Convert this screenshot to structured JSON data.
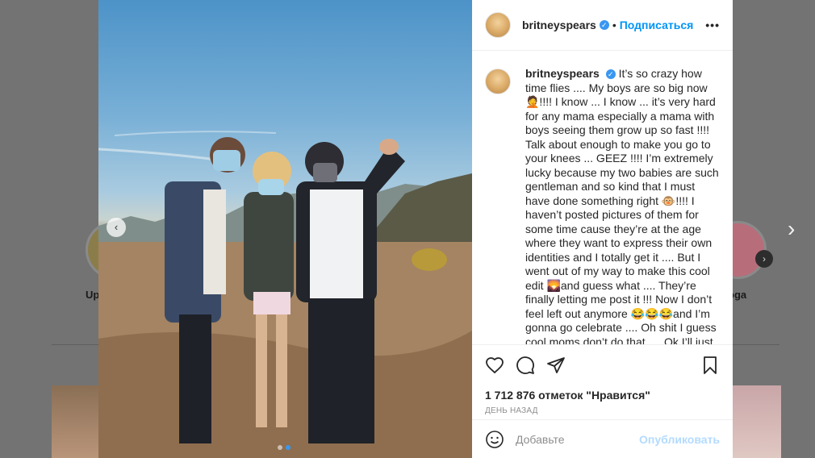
{
  "background": {
    "story_left_label": "Up",
    "story_right_label": "oga",
    "next_arrow": "›",
    "modal_next_arrow": "›"
  },
  "photo": {
    "prev_arrow": "‹",
    "carousel_dots": 2,
    "active_dot": 1
  },
  "header": {
    "username": "britneyspears",
    "verified_mark": "✓",
    "separator": "•",
    "follow_label": "Подписаться",
    "more_label": "•••"
  },
  "caption": {
    "username": "britneyspears",
    "verified_mark": "✓",
    "text": "It’s so crazy how time flies .... My boys are so big now 🤦!!!! I know ... I know ... it’s very hard for any mama especially a mama with boys seeing them grow up so fast !!!! Talk about enough to make you go to your knees ... GEEZ  !!!! I’m extremely lucky because my two babies are such gentleman and so kind that I must have done something right 🐵!!!! I haven’t posted pictures of them for some time cause they’re at the age where they want to express their own identities and I totally get it .... But I went out of my way to make this cool edit 🌄and guess what .... They’re finally letting me post it !!! Now I don’t feel left out anymore 😂😂😂and I’m gonna go celebrate .... Oh shit I guess cool moms don’t do that .... Ok I’ll just read a book"
  },
  "actions": {
    "icons": [
      "heart-icon",
      "comment-icon",
      "share-icon",
      "bookmark-icon"
    ],
    "likes": "1 712 876 отметок \"Нравится\"",
    "time_ago": "ДЕНЬ НАЗАД"
  },
  "comment": {
    "placeholder": "Добавьте",
    "publish_label": "Опубликовать"
  },
  "colors": {
    "accent": "#0095f6",
    "publish_disabled": "#b3dbff",
    "text": "#262626",
    "muted": "#8e8e8e"
  }
}
